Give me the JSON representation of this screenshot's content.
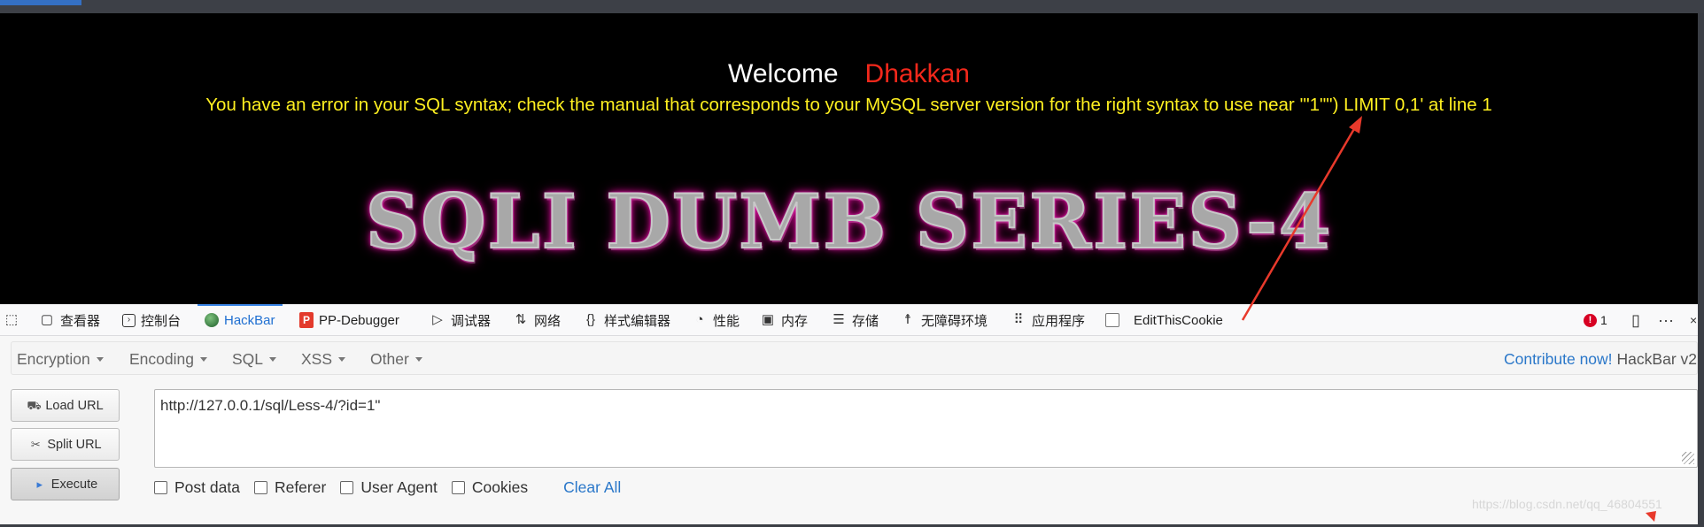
{
  "page": {
    "welcome_label": "Welcome",
    "username": "Dhakkan",
    "error_message": "You have an error in your SQL syntax; check the manual that corresponds to your MySQL server version for the right syntax to use near '\"1\"\") LIMIT 0,1' at line 1",
    "banner_text": "SQLI DUMB SERIES-4"
  },
  "devtools": {
    "tabs": [
      {
        "label": "查看器",
        "icon": "inspector-icon"
      },
      {
        "label": "控制台",
        "icon": "console-icon"
      },
      {
        "label": "HackBar",
        "icon": "hackbar-icon",
        "active": true
      },
      {
        "label": "PP-Debugger",
        "icon": "pp-debugger-icon"
      },
      {
        "label": "调试器",
        "icon": "debugger-icon"
      },
      {
        "label": "网络",
        "icon": "network-icon"
      },
      {
        "label": "样式编辑器",
        "icon": "style-editor-icon"
      },
      {
        "label": "性能",
        "icon": "performance-icon"
      },
      {
        "label": "内存",
        "icon": "memory-icon"
      },
      {
        "label": "存储",
        "icon": "storage-icon"
      },
      {
        "label": "无障碍环境",
        "icon": "accessibility-icon"
      },
      {
        "label": "应用程序",
        "icon": "application-icon"
      },
      {
        "label": "EditThisCookie",
        "icon": "cookie-checkbox-icon"
      }
    ],
    "error_count": "1"
  },
  "hackbar": {
    "menus": [
      "Encryption",
      "Encoding",
      "SQL",
      "XSS",
      "Other"
    ],
    "contribute_label": "Contribute now!",
    "version_label": "HackBar v2",
    "load_url_label": "Load URL",
    "split_url_label": "Split URL",
    "execute_label": "Execute",
    "url_value": "http://127.0.0.1/sql/Less-4/?id=1\"",
    "options": [
      "Post data",
      "Referer",
      "User Agent",
      "Cookies"
    ],
    "clear_all_label": "Clear All",
    "watermark": "https://blog.csdn.net/qq_46804551"
  },
  "colors": {
    "username": "#f2281b",
    "error_text": "#fff020",
    "link": "#2a77c9",
    "active_tab": "#1f6fd1",
    "arrow": "#e8392b"
  }
}
